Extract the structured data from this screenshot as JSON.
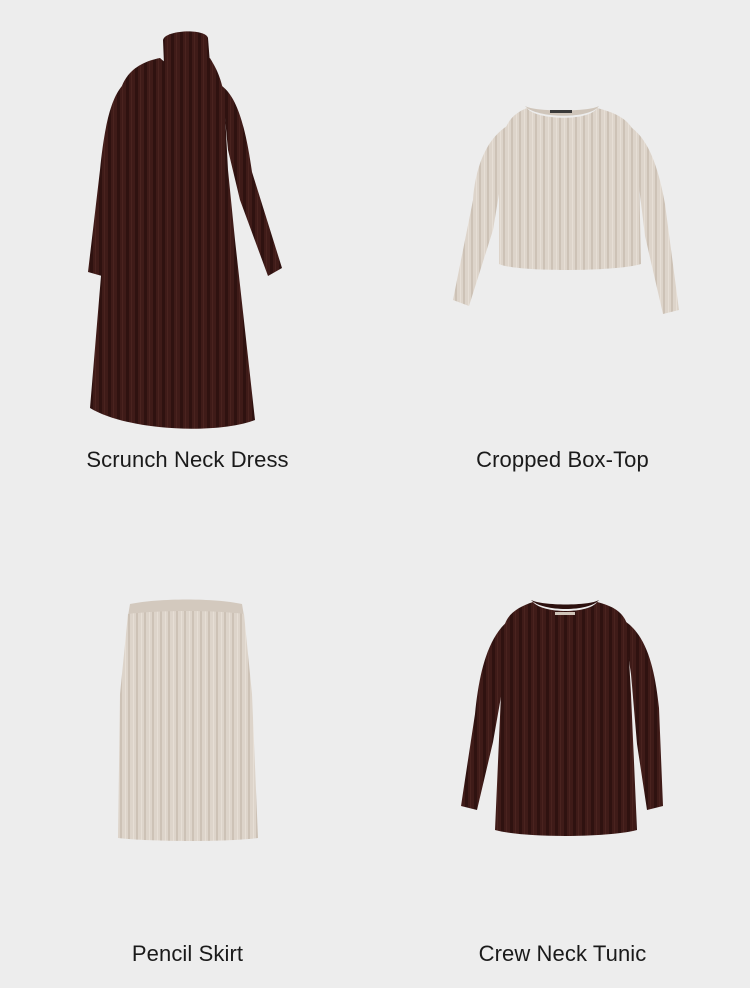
{
  "colors": {
    "background": "#ededed",
    "brown_knit": "#3d1a17",
    "oatmeal_knit": "#ddd3c9",
    "label_text": "#1a1a1a"
  },
  "products": [
    {
      "name": "Scrunch Neck Dress",
      "color": "brown",
      "image_icon": "dress-icon"
    },
    {
      "name": "Cropped Box-Top",
      "color": "oatmeal",
      "image_icon": "sweater-icon"
    },
    {
      "name": "Pencil Skirt",
      "color": "oatmeal",
      "image_icon": "skirt-icon"
    },
    {
      "name": "Crew Neck Tunic",
      "color": "brown",
      "image_icon": "tunic-icon"
    }
  ]
}
